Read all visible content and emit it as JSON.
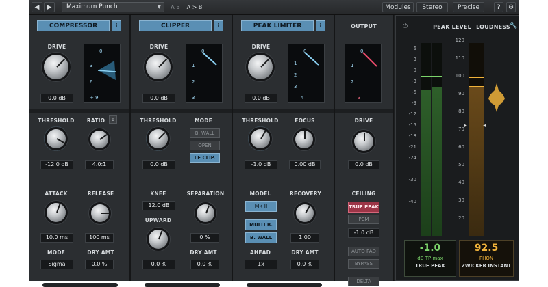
{
  "topbar": {
    "back_icon": "arrow-left-icon",
    "forward_icon": "arrow-right-icon",
    "preset_name": "Maximum Punch",
    "preset_dropdown_icon": "chevron-down-icon",
    "ab_a": "A B",
    "ab_copy": "A > B",
    "modules_label": "Modules",
    "stereo_label": "Stereo",
    "precise_label": "Precise",
    "help_label": "?",
    "settings_icon": "gear-icon"
  },
  "compressor": {
    "title": "COMPRESSOR",
    "info_icon": "info-icon",
    "drive_label": "DRIVE",
    "drive_value": "0.0 dB",
    "scope_labels": [
      "0",
      "3",
      "6",
      "+ 9"
    ],
    "threshold_label": "THRESHOLD",
    "threshold_value": "-12.0 dB",
    "ratio_label": "RATIO",
    "ratio_value": "4.0:1",
    "attack_label": "ATTACK",
    "attack_value": "10.0 ms",
    "release_label": "RELEASE",
    "release_value": "100 ms",
    "mode_label": "MODE",
    "mode_value": "Sigma",
    "dry_label": "DRY AMT",
    "dry_value": "0.0 %"
  },
  "clipper": {
    "title": "CLIPPER",
    "info_icon": "info-icon",
    "drive_label": "DRIVE",
    "drive_value": "0.0 dB",
    "scope_labels": [
      "0",
      "1",
      "2",
      "3"
    ],
    "threshold_label": "THRESHOLD",
    "threshold_value": "0.0 dB",
    "mode_label": "MODE",
    "mode_options": [
      "B. WALL",
      "OPEN",
      "LF CLIP."
    ],
    "knee_label": "KNEE",
    "knee_value": "12.0 dB",
    "separation_label": "SEPARATION",
    "separation_value": "0 %",
    "upward_label": "UPWARD",
    "upward_value": "0.0 %",
    "dry_label": "DRY AMT",
    "dry_value": "0.0 %"
  },
  "limiter": {
    "title": "PEAK LIMITER",
    "info_icon": "info-icon",
    "drive_label": "DRIVE",
    "drive_value": "0.0 dB",
    "scope_labels": [
      "0",
      "1",
      "2",
      "3",
      "4"
    ],
    "threshold_label": "THRESHOLD",
    "threshold_value": "-1.0 dB",
    "focus_label": "FOCUS",
    "focus_value": "0.00 dB",
    "model_label": "MODEL",
    "model_value": "Mk II",
    "recovery_label": "RECOVERY",
    "recovery_value": "1.00",
    "multiband_label": "MULTI B.",
    "brickwall_label": "B. WALL",
    "ahead_label": "AHEAD",
    "ahead_value": "1x",
    "dry_label": "DRY AMT",
    "dry_value": "0.0 %"
  },
  "output": {
    "title": "OUTPUT",
    "scope_labels": [
      "0",
      "1",
      "2",
      "3"
    ],
    "drive_label": "DRIVE",
    "drive_value": "0.0 dB",
    "ceiling_label": "CEILING",
    "true_peak_label": "TRUE PEAK",
    "pcm_label": "PCM",
    "ceiling_value": "-1.0 dB",
    "auto_pad_label": "AUTO PAD",
    "bypass_label": "BYPASS",
    "delta_label": "DELTA"
  },
  "meter": {
    "power_icon": "power-icon",
    "peak_title": "PEAK LEVEL",
    "loudness_title": "LOUDNESS",
    "wrench_icon": "wrench-icon",
    "peak_ticks": [
      "6",
      "3",
      "0",
      "-3",
      "-6",
      "-9",
      "-12",
      "-15",
      "-18",
      "-21",
      "-24",
      "-30",
      "-40"
    ],
    "loud_ticks": [
      "120",
      "110",
      "100",
      "90",
      "80",
      "70",
      "60",
      "50",
      "40",
      "30",
      "20"
    ],
    "peak_value": "-1.0",
    "peak_unit": "dB TP max",
    "peak_mode": "TRUE PEAK",
    "loud_value": "92.5",
    "loud_unit": "PHON",
    "loud_mode": "ZWICKER INSTANT",
    "peak_color": "#7bd36a",
    "loud_color": "#f0b23a",
    "accent_color": "#5a8fb4"
  }
}
